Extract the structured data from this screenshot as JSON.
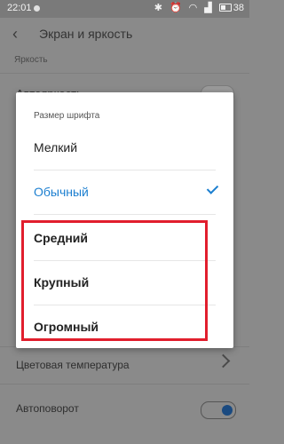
{
  "status": {
    "time": "22:01",
    "battery": "38"
  },
  "header": {
    "title": "Экран и яркость"
  },
  "background": {
    "section_label": "Яркость",
    "row1_label": "Автояркость",
    "row_color_temp": "Цветовая температура",
    "row_autorotate": "Автоповорот"
  },
  "dialog": {
    "title": "Размер шрифта",
    "options": [
      {
        "label": "Мелкий",
        "selected": false
      },
      {
        "label": "Обычный",
        "selected": true
      },
      {
        "label": "Средний",
        "selected": false
      },
      {
        "label": "Крупный",
        "selected": false
      },
      {
        "label": "Огромный",
        "selected": false
      }
    ]
  },
  "colors": {
    "accent": "#1c7fd0",
    "highlight": "#e11e2d"
  }
}
